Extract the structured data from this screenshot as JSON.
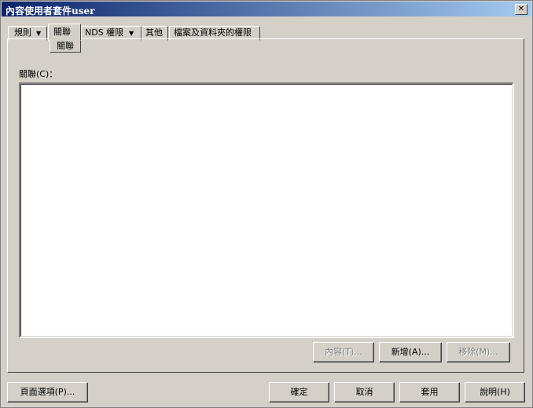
{
  "window": {
    "title": "內容使用者套件user",
    "close_glyph": "✕"
  },
  "tabs": [
    {
      "label": "規則",
      "has_dropdown": true
    },
    {
      "label": "關聯",
      "has_dropdown": false,
      "active": true
    },
    {
      "label": "NDS 權限",
      "has_dropdown": true
    },
    {
      "label": "其他",
      "has_dropdown": false
    },
    {
      "label": "檔案及資料夾的權限",
      "has_dropdown": false
    }
  ],
  "dropdown_glyph": "▼",
  "active_subtab": "關聯",
  "panel": {
    "list_label": "關聯(C)：",
    "list_items": [],
    "buttons": {
      "properties": {
        "label": "內容(T)...",
        "enabled": false
      },
      "add": {
        "label": "新增(A)...",
        "enabled": true
      },
      "remove": {
        "label": "移除(M)...",
        "enabled": false
      }
    }
  },
  "footer": {
    "page_options": "頁面選項(P)...",
    "ok": "確定",
    "cancel": "取消",
    "apply": "套用",
    "help": "說明(H)"
  }
}
